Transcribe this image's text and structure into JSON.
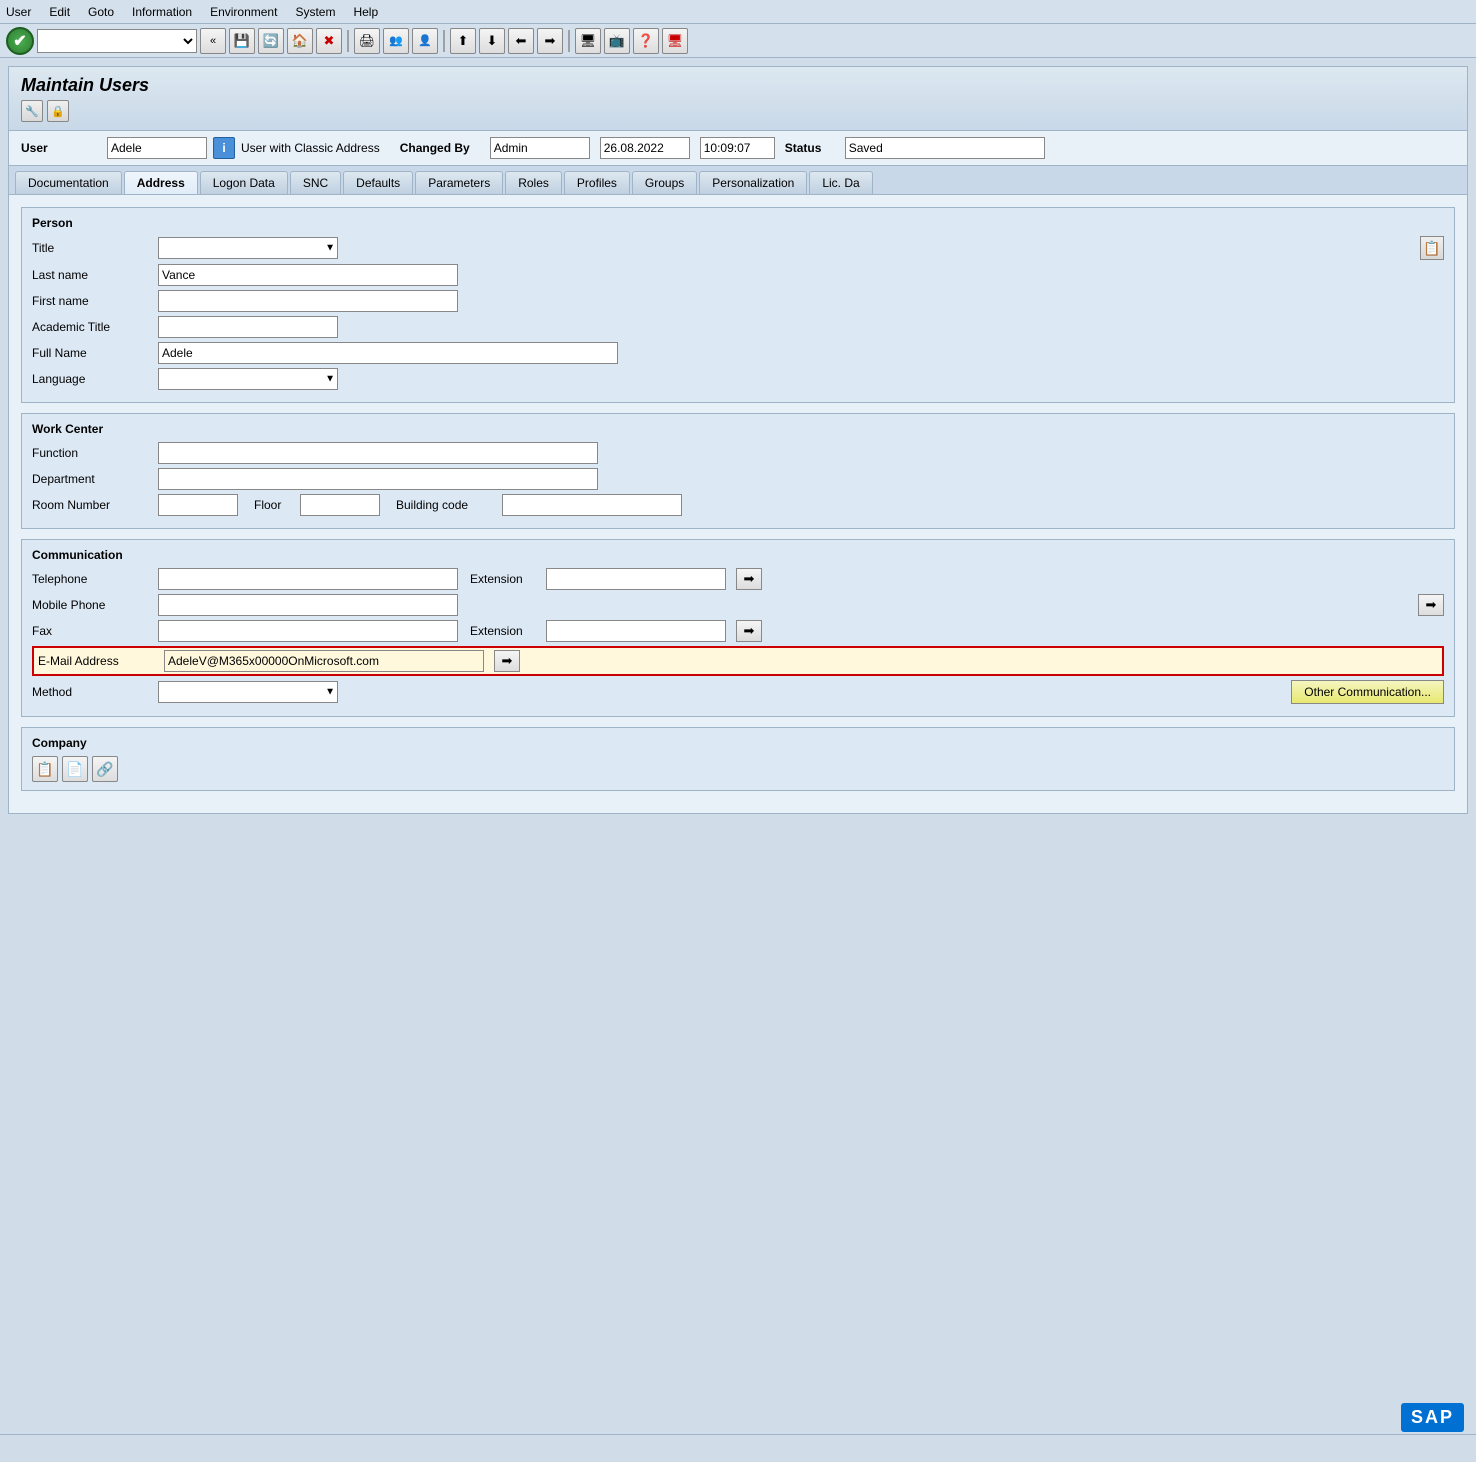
{
  "menubar": {
    "items": [
      "User",
      "Edit",
      "Goto",
      "Information",
      "Environment",
      "System",
      "Help"
    ]
  },
  "toolbar": {
    "green_check": "✔",
    "back_symbol": "«",
    "save_symbol": "💾",
    "icons": [
      "🔄",
      "🏠",
      "✖",
      "🖨",
      "👥",
      "👤",
      "⬆",
      "⬇",
      "⬅",
      "➡",
      "🖥",
      "📺",
      "❓",
      "🖥"
    ]
  },
  "title": "Maintain Users",
  "user_info": {
    "user_label": "User",
    "user_value": "Adele",
    "info_icon": "i",
    "info_text": "User with Classic Address",
    "changed_by_label": "Changed By",
    "changed_by_value": "Admin",
    "date_value": "26.08.2022",
    "time_value": "10:09:07",
    "status_label": "Status",
    "status_value": "Saved"
  },
  "tabs": [
    {
      "label": "Documentation",
      "active": false
    },
    {
      "label": "Address",
      "active": true
    },
    {
      "label": "Logon Data",
      "active": false
    },
    {
      "label": "SNC",
      "active": false
    },
    {
      "label": "Defaults",
      "active": false
    },
    {
      "label": "Parameters",
      "active": false
    },
    {
      "label": "Roles",
      "active": false
    },
    {
      "label": "Profiles",
      "active": false
    },
    {
      "label": "Groups",
      "active": false
    },
    {
      "label": "Personalization",
      "active": false
    },
    {
      "label": "Lic. Da",
      "active": false
    }
  ],
  "person_section": {
    "title": "Person",
    "title_field_label": "Title",
    "last_name_label": "Last name",
    "last_name_value": "Vance",
    "first_name_label": "First name",
    "first_name_value": "",
    "academic_title_label": "Academic Title",
    "academic_title_value": "",
    "full_name_label": "Full Name",
    "full_name_value": "Adele",
    "language_label": "Language",
    "language_value": ""
  },
  "work_center_section": {
    "title": "Work Center",
    "function_label": "Function",
    "function_value": "",
    "department_label": "Department",
    "department_value": "",
    "room_number_label": "Room Number",
    "room_number_value": "",
    "floor_label": "Floor",
    "floor_value": "",
    "building_code_label": "Building code",
    "building_code_value": ""
  },
  "communication_section": {
    "title": "Communication",
    "telephone_label": "Telephone",
    "telephone_value": "",
    "extension_label": "Extension",
    "extension_value": "",
    "mobile_label": "Mobile Phone",
    "mobile_value": "",
    "fax_label": "Fax",
    "fax_value": "",
    "fax_ext_label": "Extension",
    "fax_ext_value": "",
    "email_label": "E-Mail Address",
    "email_value": "AdeleV@M365x00000OnMicrosoft.com",
    "method_label": "Method",
    "method_value": "",
    "other_comm_btn": "Other Communication..."
  },
  "company_section": {
    "title": "Company"
  },
  "sap_logo": "SAP"
}
